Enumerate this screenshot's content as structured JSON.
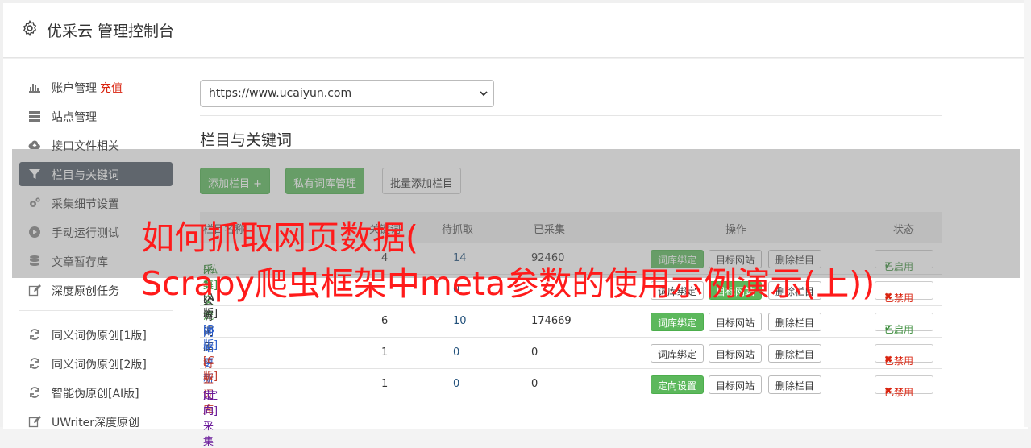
{
  "app": {
    "title": "优采云 管理控制台"
  },
  "sidebar": {
    "items": [
      {
        "label": "账户管理",
        "extra": "充值"
      },
      {
        "label": "站点管理"
      },
      {
        "label": "接口文件相关"
      },
      {
        "label": "栏目与关键词"
      },
      {
        "label": "采集细节设置"
      },
      {
        "label": "手动运行测试"
      },
      {
        "label": "文章暂存库"
      },
      {
        "label": "深度原创任务"
      }
    ],
    "items2": [
      {
        "label": "同义词伪原创[1版]"
      },
      {
        "label": "同义词伪原创[2版]"
      },
      {
        "label": "智能伪原创[AI版]"
      },
      {
        "label": "UWriter深度原创"
      }
    ]
  },
  "site_select": {
    "value": "https://www.ucaiyun.com"
  },
  "section": {
    "title": "栏目与关键词"
  },
  "toolbar": {
    "add_column": "添加栏目 +",
    "private_lib": "私有词库管理",
    "batch_add": "批量添加栏目"
  },
  "table": {
    "headers": [
      "栏目名称",
      "关键词",
      "待抓取",
      "已采集",
      "操作",
      "状态"
    ],
    "rows": [
      {
        "tag": "[私有]",
        "name": "采集交流",
        "n1": "4",
        "n2": "14",
        "n3": "92460",
        "op1": "词库绑定",
        "op2": "目标网站",
        "op3": "删除栏目",
        "status": "已启用",
        "tag_color": "#3c8d3c",
        "name_color": "#3c8d3c"
      },
      {
        "tag": "[A版]",
        "name": "公有词库",
        "n1": "",
        "n2": "0",
        "n3": "",
        "op1": "词库绑定",
        "op2": "目标网站",
        "op3": "删除栏目",
        "status": "已禁用",
        "tag_color": "#333333",
        "name_color": "#333333"
      },
      {
        "tag": "[B版]",
        "name": "网站更新",
        "n1": "6",
        "n2": "10",
        "n3": "174669",
        "op1": "词库绑定",
        "op2": "目标网站",
        "op3": "删除栏目",
        "status": "已启用",
        "tag_color": "#2a5dcc",
        "name_color": "#2a5dcc"
      },
      {
        "tag": "[C版]",
        "name": "行业词库",
        "n1": "1",
        "n2": "0",
        "n3": "0",
        "op1": "词库绑定",
        "op2": "目标网站",
        "op3": "删除栏目",
        "status": "已禁用",
        "tag_color": "#c0392b",
        "name_color": "#c0392b"
      },
      {
        "tag": "[定向]",
        "name": "定向采集",
        "n1": "1",
        "n2": "0",
        "n3": "0",
        "op1": "定向设置",
        "op2": "目标网站",
        "op3": "删除栏目",
        "status": "已禁用",
        "tag_color": "#6a1b9a",
        "name_color": "#6a1b9a"
      }
    ]
  },
  "overlay": {
    "line1": "如何抓取网页数据(",
    "line2": "Scrapy爬虫框架中meta参数的使用示例演示(上))"
  },
  "colors": {
    "accent": "#5cb85c",
    "active_nav": "#505b66",
    "overlay_text": "#ff1b1b"
  }
}
